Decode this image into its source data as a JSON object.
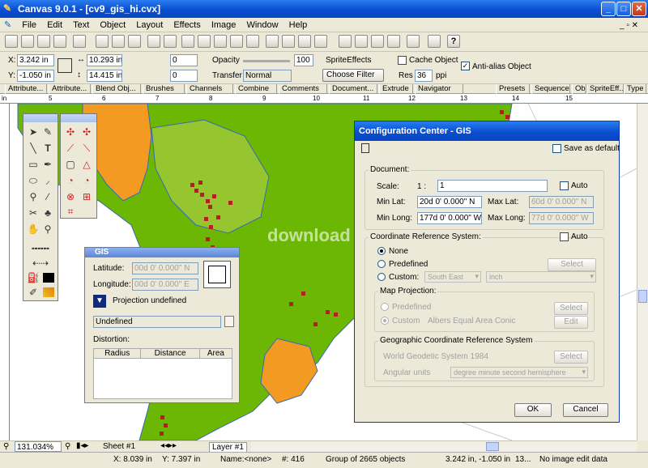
{
  "window": {
    "title": "Canvas 9.0.1 - [cv9_gis_hi.cvx]"
  },
  "menu": [
    "File",
    "Edit",
    "Text",
    "Object",
    "Layout",
    "Effects",
    "Image",
    "Window",
    "Help"
  ],
  "toolbar_icons": [
    "new-icon",
    "open-icon",
    "save-icon",
    "save-all-icon",
    "print-icon",
    "print-preview-icon",
    "cut-icon",
    "copy-icon",
    "paste-icon",
    "undo-icon",
    "redo-icon",
    "group-icon",
    "lock-icon",
    "align-icon",
    "combine-icon",
    "duplicate-icon",
    "delete-icon",
    "transform-icon",
    "clip-icon",
    "zoom-fit-icon",
    "find-icon",
    "help-icon"
  ],
  "props": {
    "x_label": "X:",
    "x_value": "3.242 in",
    "y_label": "Y:",
    "y_value": "-1.050 in",
    "w_value": "10.293 in",
    "h_value": "14.415 in",
    "rot_value": "0",
    "skew_value": "0",
    "opacity_label": "Opacity",
    "opacity_value": "100",
    "transfer_label": "Transfer",
    "transfer_value": "Normal",
    "sprite_effects_label": "SpriteEffects",
    "choose_filter_label": "Choose Filter",
    "cache_object_label": "Cache Object",
    "res_label": "Res",
    "res_value": "36",
    "ppi_label": "ppi",
    "anti_alias_label": "Anti-alias Object"
  },
  "tabs": [
    "Attribute...",
    "Attribute...",
    "Blend Obj...",
    "Brushes",
    "Channels",
    "Combine",
    "Comments",
    "Document...",
    "Extrude",
    "Navigator",
    "Presets",
    "Sequences",
    "Obj",
    "SpriteEff...",
    "Type"
  ],
  "ruler_marks": [
    "in",
    "5",
    "6",
    "7",
    "8",
    "9",
    "10",
    "11",
    "12",
    "13",
    "14",
    "15"
  ],
  "watermark": "download",
  "gis_palette": {
    "title": "GIS",
    "latitude_label": "Latitude:",
    "latitude_value": "00d 0' 0.000\" N",
    "longitude_label": "Longitude:",
    "longitude_value": "00d 0' 0.000\" E",
    "projection_label": "Projection undefined",
    "select_value": "Undefined",
    "distortion_label": "Distortion:",
    "columns": [
      "Radius",
      "Distance",
      "Area"
    ]
  },
  "dialog": {
    "title": "Configuration Center - GIS",
    "save_default_label": "Save as default",
    "document_group": "Document:",
    "scale_label": "Scale:",
    "scale_prefix": "1 :",
    "scale_value": "1",
    "auto_label": "Auto",
    "min_lat_label": "Min Lat:",
    "min_lat_value": "20d 0' 0.000\" N",
    "max_lat_label": "Max Lat:",
    "max_lat_value": "60d 0' 0.000\" N",
    "min_long_label": "Min Long:",
    "min_long_value": "177d 0' 0.000\" W",
    "max_long_label": "Max Long:",
    "max_long_value": "77d 0' 0.000\" W",
    "crs_group": "Coordinate Reference System:",
    "crs_auto_label": "Auto",
    "none_label": "None",
    "predefined_label": "Predefined",
    "custom_label": "Custom:",
    "select_label": "Select",
    "custom_zone": "South East",
    "custom_unit": "inch",
    "map_projection_group": "Map Projection:",
    "mp_predefined_label": "Predefined",
    "mp_custom_label": "Custom",
    "mp_custom_value": "Albers Equal Area Conic",
    "edit_label": "Edit",
    "gcrs_group": "Geographic Coordinate Reference System",
    "gcrs_value": "World Geodetic System 1984",
    "angular_units_label": "Angular units",
    "angular_units_value": "degree minute second hemisphere",
    "ok_label": "OK",
    "cancel_label": "Cancel"
  },
  "nav": {
    "zoom": "131.034%",
    "sheet": "Sheet #1",
    "layer": "Layer #1"
  },
  "status": {
    "cursor_x": "X: 8.039 in",
    "cursor_y": "Y: 7.397 in",
    "name": "Name:<none>",
    "count": "#: 416",
    "group": "Group of 2665 objects",
    "pos": "3.242 in, -1.050 in",
    "size": "13...",
    "image_edit": "No image edit data"
  },
  "colors": {
    "land": "#6cb604",
    "highlight_land": "#95c62f",
    "orange_region": "#f29a22",
    "marker": "#b22020",
    "title_blue": "#0a4fd0"
  }
}
